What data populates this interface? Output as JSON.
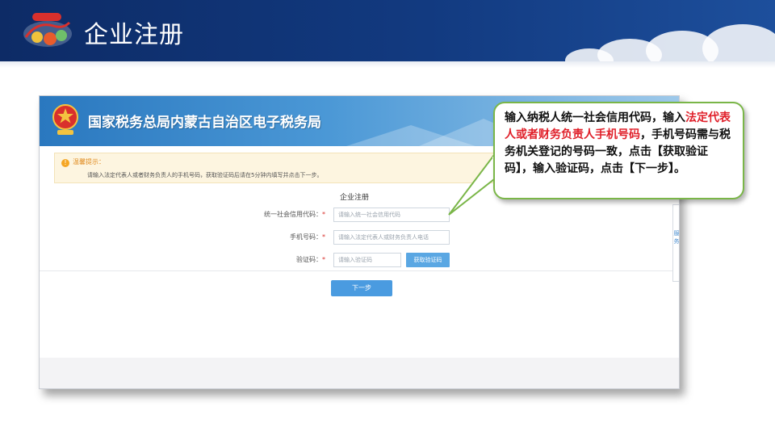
{
  "slide": {
    "title": "企业注册"
  },
  "site": {
    "title": "国家税务总局内蒙古自治区电子税务局"
  },
  "notice": {
    "title": "温馨提示：",
    "text": "请输入法定代表人或者财务负责人的手机号码，获取验证码后请在5分钟内填写并点击下一步。"
  },
  "form": {
    "heading": "企业注册",
    "fields": [
      {
        "label": "统一社会信用代码：",
        "required": "*",
        "placeholder": "请输入统一社会信用代码"
      },
      {
        "label": "手机号码：",
        "required": "*",
        "placeholder": "请输入法定代表人或财务负责人电话"
      },
      {
        "label": "验证码：",
        "required": "*",
        "placeholder": "请输入验证码"
      }
    ],
    "code_button": "获取验证码",
    "next_button": "下一步"
  },
  "side_widget": {
    "chars": [
      "服",
      "务"
    ]
  },
  "callout": {
    "part1": "输入纳税人统一社会信用代码，输入",
    "highlight": "法定代表人或者财务负责人手机号码",
    "part2": "，手机号码需与税务机关登记的号码一致，点击【获取验证码】，输入验证码，点击【下一步】。"
  },
  "colors": {
    "slide_banner": "#123a80",
    "site_banner": "#2a78bf",
    "button_blue": "#4a9be0",
    "callout_border": "#7ab648",
    "highlight_red": "#e0202a",
    "notice_bg": "#fdf5e0"
  }
}
